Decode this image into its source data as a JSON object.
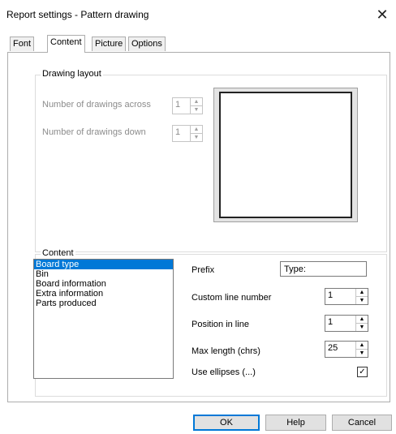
{
  "window": {
    "title": "Report settings - Pattern drawing",
    "close_glyph": "✕"
  },
  "tabs": [
    {
      "label": "Font"
    },
    {
      "label": "Content"
    },
    {
      "label": "Picture"
    },
    {
      "label": "Options"
    }
  ],
  "drawing_layout": {
    "title": "Drawing layout",
    "across_label": "Number of drawings across",
    "across_value": "1",
    "down_label": "Number of drawings down",
    "down_value": "1"
  },
  "content": {
    "title": "Content",
    "items": [
      "Board type",
      "Bin",
      "Board information",
      "Extra information",
      "Parts produced"
    ],
    "selected_index": 0,
    "prefix_label": "Prefix",
    "prefix_value": "Type:",
    "custom_line_label": "Custom line number",
    "custom_line_value": "1",
    "position_label": "Position in line",
    "position_value": "1",
    "max_length_label": "Max length (chrs)",
    "max_length_value": "25",
    "ellipses_label": "Use ellipses (...)",
    "ellipses_checked": true,
    "check_glyph": "✓"
  },
  "spinner": {
    "up_glyph": "▲",
    "down_glyph": "▼"
  },
  "buttons": {
    "ok": "OK",
    "help": "Help",
    "cancel": "Cancel"
  },
  "colors": {
    "selection": "#0078d7",
    "default_button_border": "#0078d7"
  }
}
